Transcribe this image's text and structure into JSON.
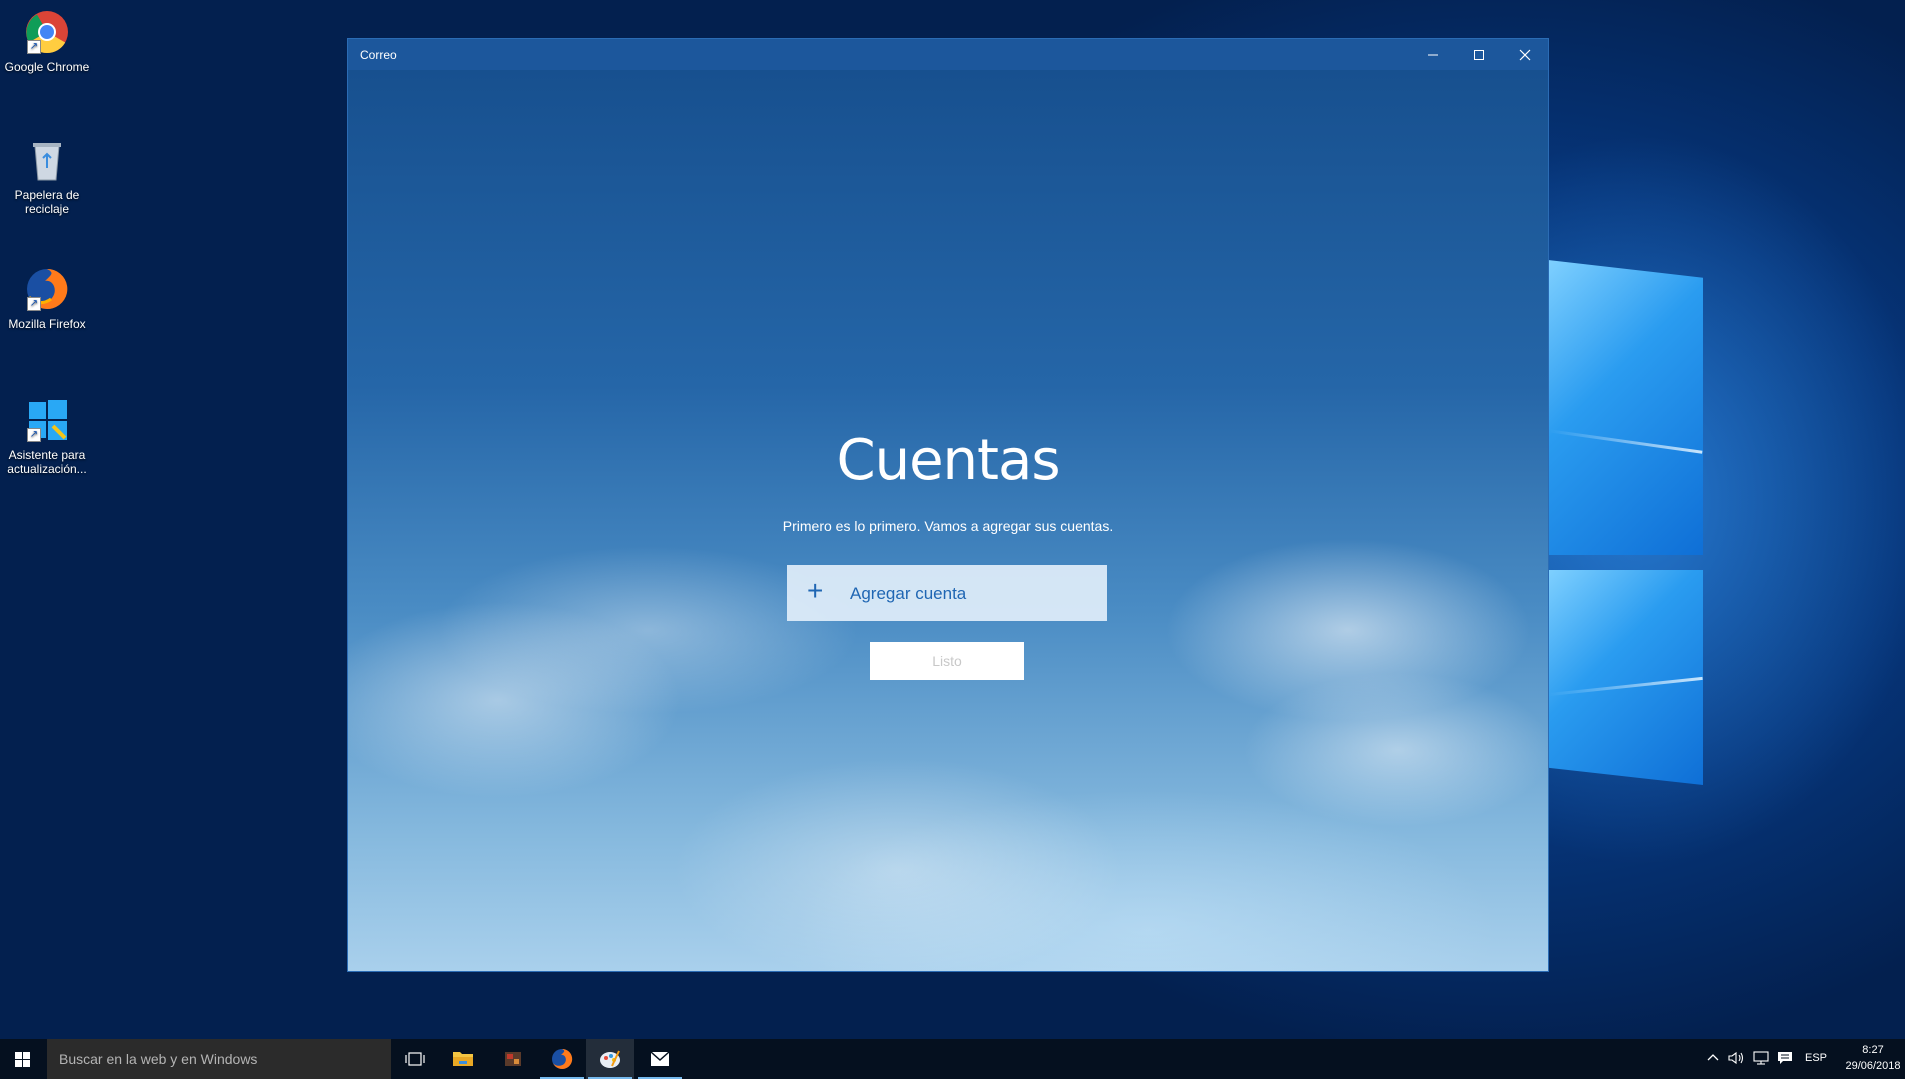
{
  "desktop": {
    "icons": [
      {
        "label": "Google Chrome",
        "icon": "chrome-icon"
      },
      {
        "label": "Papelera de reciclaje",
        "icon": "recycle-bin-icon"
      },
      {
        "label": "Mozilla Firefox",
        "icon": "firefox-icon"
      },
      {
        "label": "Asistente para actualización...",
        "icon": "windows-update-assistant-icon"
      }
    ]
  },
  "window": {
    "title": "Correo",
    "controls": {
      "minimize": "—",
      "maximize": "☐",
      "close": "✕"
    }
  },
  "accounts": {
    "heading": "Cuentas",
    "subtitle": "Primero es lo primero. Vamos a agregar sus cuentas.",
    "add_account_icon": "+",
    "add_account_label": "Agregar cuenta",
    "done_label": "Listo"
  },
  "taskbar": {
    "search_placeholder": "Buscar en la web y en Windows",
    "pinned": [
      {
        "name": "task-view",
        "icon": "task-view-icon"
      },
      {
        "name": "file-explorer",
        "icon": "folder-icon"
      },
      {
        "name": "app",
        "icon": "app-icon"
      },
      {
        "name": "firefox",
        "icon": "firefox-icon"
      },
      {
        "name": "paint",
        "icon": "paint-icon",
        "active": true
      },
      {
        "name": "mail",
        "icon": "mail-icon",
        "running": true
      }
    ],
    "tray": {
      "language": "ESP",
      "time": "8:27",
      "date": "29/06/2018"
    }
  },
  "colors": {
    "accent": "#1f66b3",
    "titlebar": "#1c579c",
    "taskbar": "#05101f"
  }
}
